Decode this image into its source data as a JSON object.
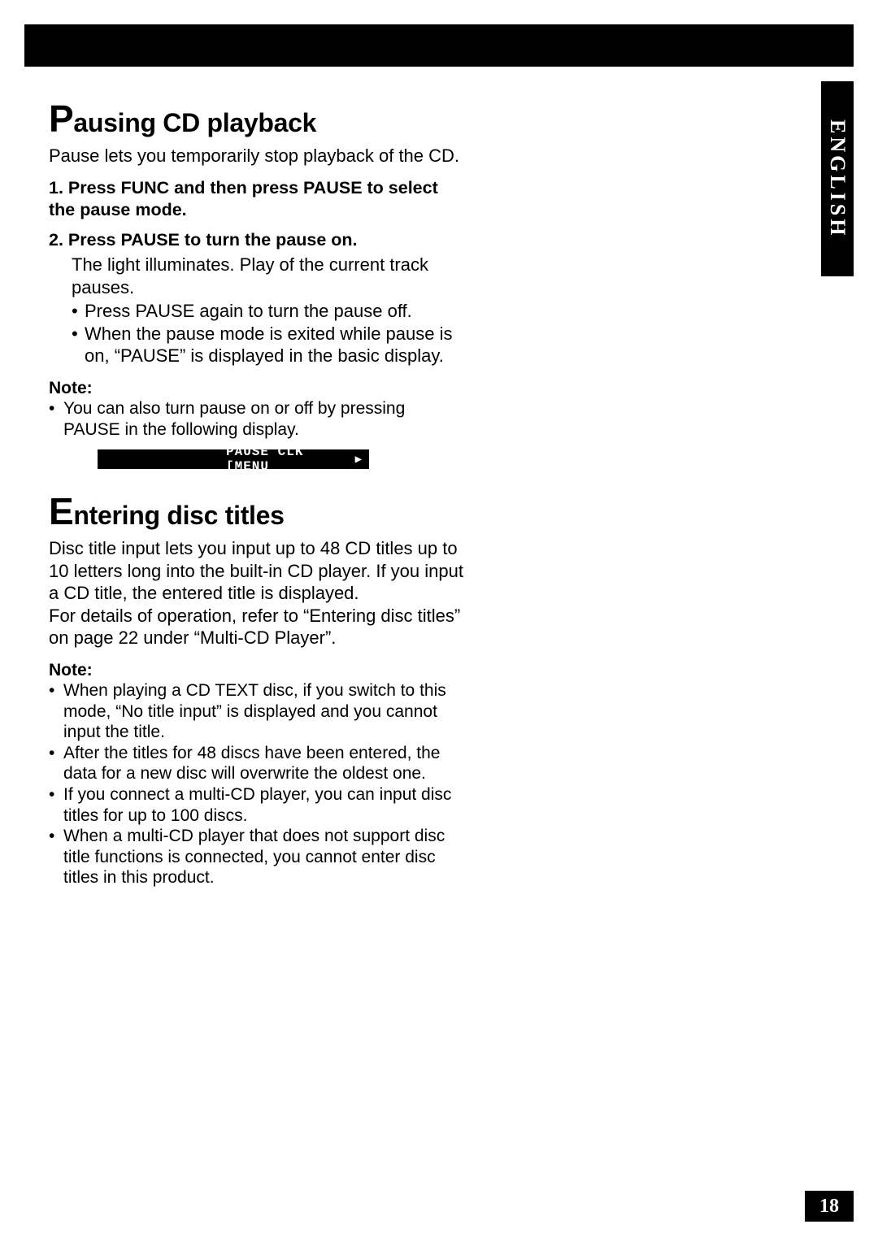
{
  "lang_tab": "ENGLISH",
  "page_number": "18",
  "section1": {
    "title_big": "P",
    "title_rest": "ausing CD playback",
    "intro": "Pause lets you temporarily stop playback of the CD.",
    "steps": [
      {
        "num": "1.",
        "title": "Press FUNC and then press PAUSE to select the pause mode."
      },
      {
        "num": "2.",
        "title": "Press PAUSE to turn the pause on.",
        "body": "The light illuminates. Play of the current track pauses.",
        "bullets": [
          "Press PAUSE again to turn the pause off.",
          "When the pause mode is exited while pause is on, “PAUSE” is displayed in the basic display."
        ]
      }
    ],
    "note_label": "Note:",
    "notes": [
      "You can also turn pause on or off by pressing PAUSE in the following display."
    ],
    "lcd_text": "PAUSE   CLK  [MENU",
    "lcd_arrow": "▶"
  },
  "section2": {
    "title_big": "E",
    "title_rest": "ntering disc titles",
    "para1": "Disc title input lets you input up to 48 CD titles up to 10 letters long into the built-in CD player. If you input a CD title, the entered title is displayed.",
    "para2": "For details of operation, refer to “Entering disc titles” on page 22 under “Multi-CD Player”.",
    "note_label": "Note:",
    "notes": [
      "When playing a CD TEXT disc, if you switch to this mode, “No title input” is displayed and you cannot input the title.",
      "After the titles for 48 discs have been entered, the data for a new disc will overwrite the oldest one.",
      "If you connect a multi-CD player, you can input disc titles for up to 100 discs.",
      "When a multi-CD player that does not support disc title functions is connected, you cannot enter disc titles in this product."
    ]
  }
}
